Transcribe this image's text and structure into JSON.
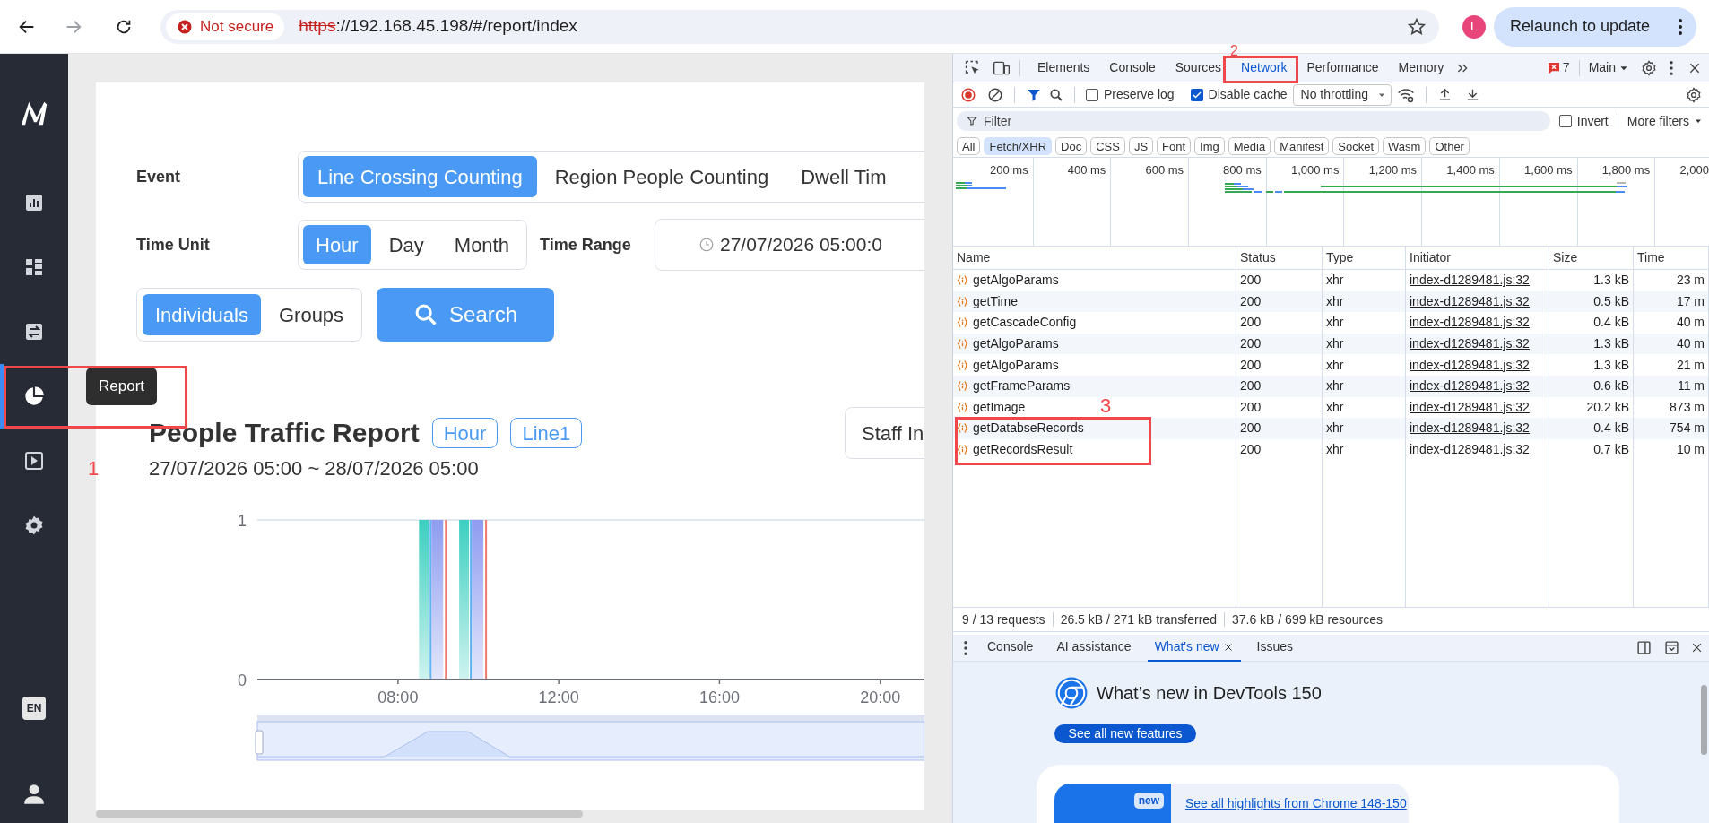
{
  "browser": {
    "not_secure": "Not secure",
    "url_scheme": "https",
    "url_rest": "://192.168.45.198/#/report/index",
    "avatar": "L",
    "relaunch": "Relaunch to update"
  },
  "sidebar": {
    "items": [
      {
        "kind": "chart",
        "selected": false
      },
      {
        "kind": "dashboard",
        "selected": false
      },
      {
        "kind": "adjust",
        "selected": false
      },
      {
        "kind": "report",
        "selected": true
      },
      {
        "kind": "playback",
        "selected": false
      },
      {
        "kind": "settings",
        "selected": false
      }
    ],
    "bottom": [
      {
        "kind": "language",
        "label": "EN"
      },
      {
        "kind": "user"
      }
    ],
    "tooltip": "Report"
  },
  "report": {
    "event": {
      "label": "Event",
      "options": [
        {
          "label": "Line Crossing Counting",
          "selected": true
        },
        {
          "label": "Region People Counting",
          "selected": false
        },
        {
          "label": "Dwell Tim",
          "selected": false
        }
      ]
    },
    "time_unit": {
      "label": "Time Unit",
      "options": [
        {
          "label": "Hour",
          "selected": true
        },
        {
          "label": "Day",
          "selected": false
        },
        {
          "label": "Month",
          "selected": false
        }
      ]
    },
    "time_range": {
      "label": "Time Range",
      "value": "27/07/2026 05:00:0"
    },
    "mode": {
      "options": [
        {
          "label": "Individuals",
          "selected": true
        },
        {
          "label": "Groups",
          "selected": false
        }
      ]
    },
    "search_button": "Search",
    "title": "People Traffic Report",
    "tags": [
      "Hour",
      "Line1"
    ],
    "staff_button": "Staff In",
    "date_range": "27/07/2026 05:00 ~ 28/07/2026 05:00",
    "chart_data": {
      "type": "bar",
      "x": [
        9,
        10
      ],
      "series": [
        {
          "color": "#3ccfc0",
          "values": [
            1,
            1
          ]
        },
        {
          "color": "#5fb4f3",
          "values": [
            1,
            1
          ]
        },
        {
          "color": "#8e9cf0",
          "values": [
            1,
            1
          ]
        },
        {
          "color": "#f0786e",
          "values": [
            1,
            1
          ]
        }
      ],
      "xlim": [
        4.5,
        21.1
      ],
      "ylim": [
        0,
        1
      ],
      "yticks": [
        0,
        1
      ],
      "xticks": [
        {
          "value": 8,
          "label": "08:00"
        },
        {
          "value": 12,
          "label": "12:00"
        },
        {
          "value": 16,
          "label": "16:00"
        },
        {
          "value": 20,
          "label": "20:00"
        }
      ]
    }
  },
  "devtools": {
    "tabs": [
      {
        "label": "Elements",
        "selected": false
      },
      {
        "label": "Console",
        "selected": false
      },
      {
        "label": "Sources",
        "selected": false
      },
      {
        "label": "Network",
        "selected": true
      },
      {
        "label": "Performance",
        "selected": false
      },
      {
        "label": "Memory",
        "selected": false
      }
    ],
    "issues_count": "7",
    "context": "Main",
    "preserve_log": {
      "label": "Preserve log",
      "checked": false
    },
    "disable_cache": {
      "label": "Disable cache",
      "checked": true
    },
    "throttling": "No throttling",
    "filter": {
      "placeholder": "Filter"
    },
    "invert": {
      "label": "Invert",
      "checked": false
    },
    "more_filters": "More filters",
    "type_filters": [
      {
        "label": "All",
        "selected": false
      },
      {
        "label": "Fetch/XHR",
        "selected": true
      },
      {
        "label": "Doc",
        "selected": false
      },
      {
        "label": "CSS",
        "selected": false
      },
      {
        "label": "JS",
        "selected": false
      },
      {
        "label": "Font",
        "selected": false
      },
      {
        "label": "Img",
        "selected": false
      },
      {
        "label": "Media",
        "selected": false
      },
      {
        "label": "Manifest",
        "selected": false
      },
      {
        "label": "Socket",
        "selected": false
      },
      {
        "label": "Wasm",
        "selected": false
      },
      {
        "label": "Other",
        "selected": false
      }
    ],
    "overview_ticks": [
      "200 ms",
      "400 ms",
      "600 ms",
      "800 ms",
      "1,000 ms",
      "1,200 ms",
      "1,400 ms",
      "1,600 ms",
      "1,800 ms",
      "2,000"
    ],
    "columns": [
      "Name",
      "Status",
      "Type",
      "Initiator",
      "Size",
      "Time"
    ],
    "rows": [
      {
        "name": "getAlgoParams",
        "status": "200",
        "type": "xhr",
        "initiator": "index-d1289481.js:32",
        "size": "1.3 kB",
        "time": "23 m"
      },
      {
        "name": "getTime",
        "status": "200",
        "type": "xhr",
        "initiator": "index-d1289481.js:32",
        "size": "0.5 kB",
        "time": "17 m"
      },
      {
        "name": "getCascadeConfig",
        "status": "200",
        "type": "xhr",
        "initiator": "index-d1289481.js:32",
        "size": "0.4 kB",
        "time": "40 m"
      },
      {
        "name": "getAlgoParams",
        "status": "200",
        "type": "xhr",
        "initiator": "index-d1289481.js:32",
        "size": "1.3 kB",
        "time": "40 m"
      },
      {
        "name": "getAlgoParams",
        "status": "200",
        "type": "xhr",
        "initiator": "index-d1289481.js:32",
        "size": "1.3 kB",
        "time": "21 m"
      },
      {
        "name": "getFrameParams",
        "status": "200",
        "type": "xhr",
        "initiator": "index-d1289481.js:32",
        "size": "0.6 kB",
        "time": "11 m"
      },
      {
        "name": "getImage",
        "status": "200",
        "type": "xhr",
        "initiator": "index-d1289481.js:32",
        "size": "20.2 kB",
        "time": "873 m"
      },
      {
        "name": "getDatabseRecords",
        "status": "200",
        "type": "xhr",
        "initiator": "index-d1289481.js:32",
        "size": "0.4 kB",
        "time": "754 m"
      },
      {
        "name": "getRecordsResult",
        "status": "200",
        "type": "xhr",
        "initiator": "index-d1289481.js:32",
        "size": "0.7 kB",
        "time": "10 m"
      }
    ],
    "summary": [
      "9 / 13 requests",
      "26.5 kB / 271 kB transferred",
      "37.6 kB / 699 kB resources"
    ],
    "drawer_tabs": [
      {
        "label": "Console",
        "selected": false
      },
      {
        "label": "AI assistance",
        "selected": false
      },
      {
        "label": "What's new",
        "selected": true
      },
      {
        "label": "Issues",
        "selected": false
      }
    ],
    "whats_new": {
      "title": "What’s new in DevTools 150",
      "button": "See all new features",
      "badge": "new",
      "link": "See all highlights from Chrome 148-150"
    }
  },
  "annotations": [
    {
      "label": "1"
    },
    {
      "label": "2"
    },
    {
      "label": "3"
    }
  ]
}
